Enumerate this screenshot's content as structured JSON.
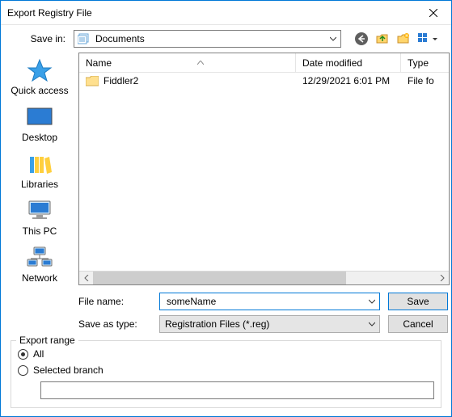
{
  "window": {
    "title": "Export Registry File"
  },
  "toolbar": {
    "save_in_label": "Save in:",
    "save_in_value": "Documents"
  },
  "places": [
    {
      "id": "quick-access",
      "label": "Quick access"
    },
    {
      "id": "desktop",
      "label": "Desktop"
    },
    {
      "id": "libraries",
      "label": "Libraries"
    },
    {
      "id": "this-pc",
      "label": "This PC"
    },
    {
      "id": "network",
      "label": "Network"
    }
  ],
  "filelist": {
    "columns": {
      "name": "Name",
      "date": "Date modified",
      "type": "Type"
    },
    "rows": [
      {
        "name": "Fiddler2",
        "date": "12/29/2021 6:01 PM",
        "type": "File fo"
      }
    ]
  },
  "fields": {
    "file_name_label": "File name:",
    "file_name_value": "someName",
    "save_as_type_label": "Save as type:",
    "save_as_type_value": "Registration Files (*.reg)"
  },
  "buttons": {
    "save": "Save",
    "cancel": "Cancel"
  },
  "export": {
    "legend": "Export range",
    "all": "All",
    "selected_branch": "Selected branch",
    "selected_value": "all"
  }
}
